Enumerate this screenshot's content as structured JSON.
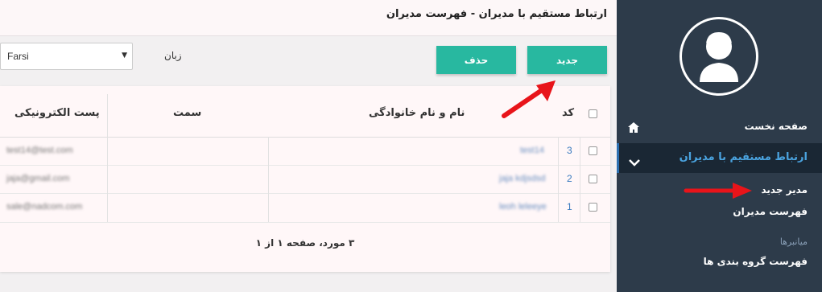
{
  "page_title": "ارتباط مستقیم با مدیران - فهرست مدیران",
  "toolbar": {
    "new_label": "جدید",
    "delete_label": "حذف"
  },
  "language": {
    "label": "زبان",
    "selected": "Farsi"
  },
  "table": {
    "headers": {
      "id": "کد",
      "name": "نام و نام خانوادگی",
      "position": "سمت",
      "email": "پست الکترونیکی"
    },
    "rows": [
      {
        "id": "3",
        "name": "test14",
        "email": "test14@test.com"
      },
      {
        "id": "2",
        "name": "jaja kdjsdsd",
        "email": "jaja@gmail.com"
      },
      {
        "id": "1",
        "name": "leoh leleeye",
        "email": "sale@nadcom.com"
      }
    ],
    "footer": "۳ مورد، صفحه ۱ از ۱"
  },
  "sidebar": {
    "home": "صفحه نخست",
    "active": "ارتباط مستقیم با مدیران",
    "sub_items": [
      "مدیر جدید",
      "فهرست مدیران"
    ],
    "section_title": "میانبرها",
    "section_item": "فهرست گروه بندی ها"
  },
  "icons": {
    "home": "home-icon",
    "chevron": "chevron-down-icon",
    "avatar": "user-avatar-icon",
    "caret": "select-caret-icon"
  },
  "colors": {
    "accent_button": "#28b8a0",
    "sidebar_bg": "#2d3b4a",
    "active_link": "#4aa3df",
    "annotation_arrow": "#e8141a"
  }
}
